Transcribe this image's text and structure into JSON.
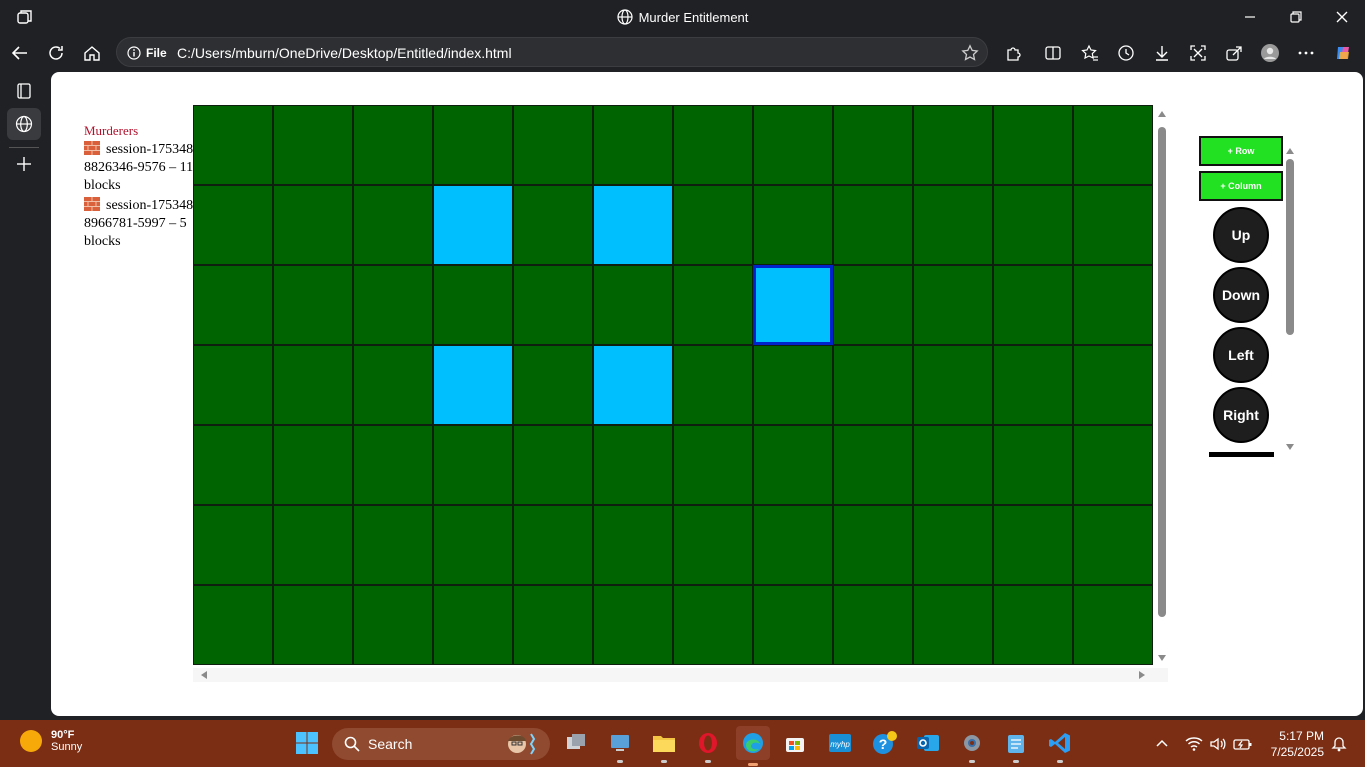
{
  "window": {
    "title": "Murder Entitlement"
  },
  "address_bar": {
    "scheme_label": "File",
    "url": "C:/Users/mburn/OneDrive/Desktop/Entitled/index.html"
  },
  "murderers": {
    "heading": "Murderers",
    "entries": [
      {
        "text": "session-1753488826346-9576 – 11 blocks"
      },
      {
        "text": "session-1753488966781-5997 – 5 blocks"
      }
    ]
  },
  "grid": {
    "columns": 12,
    "rows": 7,
    "colors": {
      "ground": "#006400",
      "block": "#00bfff",
      "selected_border": "#0022cc"
    },
    "blocks": [
      [
        1,
        3
      ],
      [
        1,
        5
      ],
      [
        3,
        3
      ],
      [
        3,
        5
      ],
      [
        2,
        7
      ]
    ],
    "selected": [
      2,
      7
    ]
  },
  "controls": {
    "add_row": "+ Row",
    "add_column": "+ Column",
    "up": "Up",
    "down": "Down",
    "left": "Left",
    "right": "Right"
  },
  "taskbar": {
    "weather": {
      "temp": "90°F",
      "condition": "Sunny"
    },
    "search_label": "Search",
    "time": "5:17 PM",
    "date": "7/25/2025"
  }
}
